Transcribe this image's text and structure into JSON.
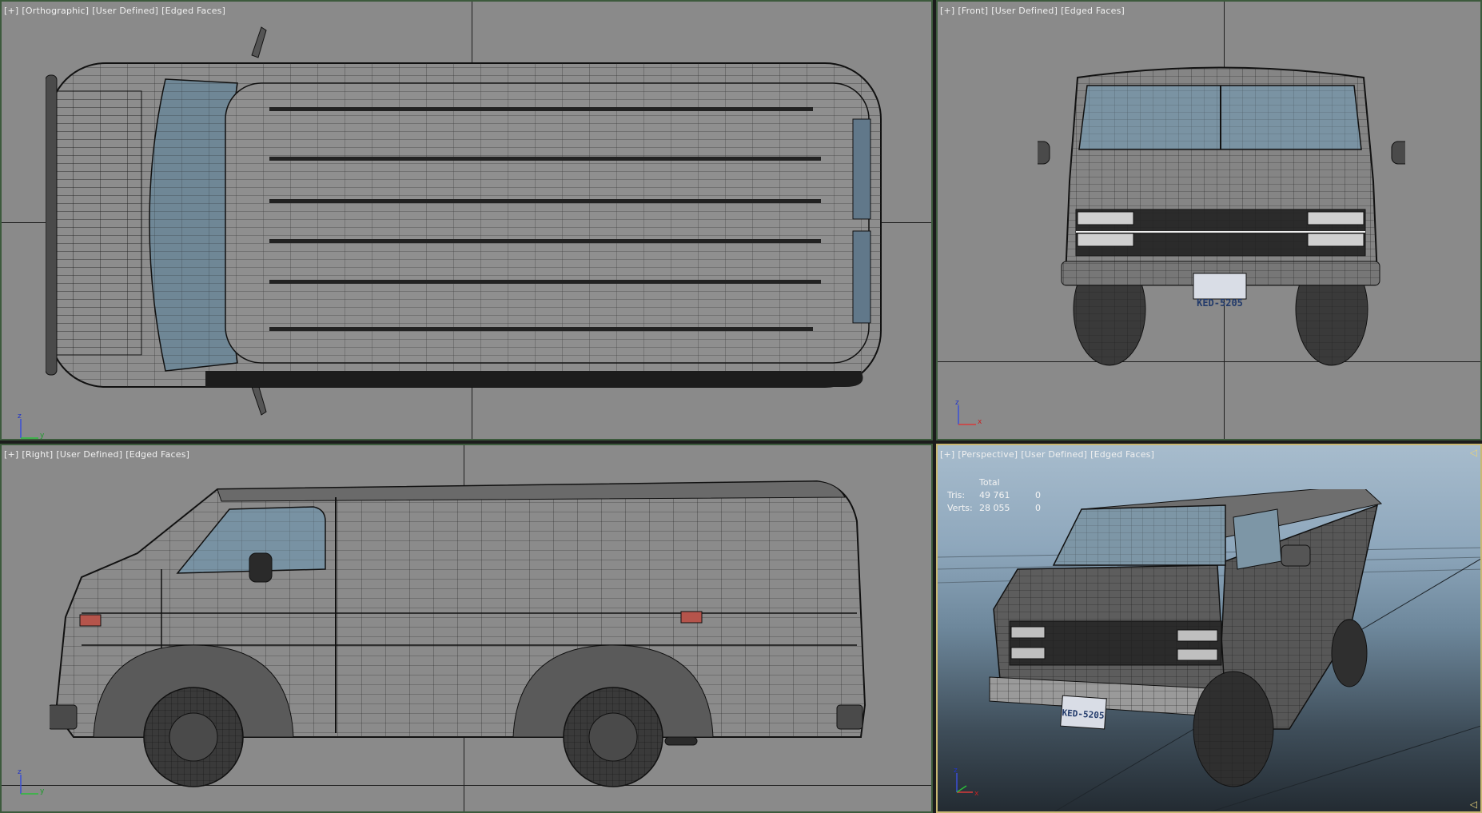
{
  "viewports": {
    "top": {
      "label_plus": "[+]",
      "label_view": "[Orthographic]",
      "label_shading": "[User Defined]",
      "label_faces": "[Edged Faces]"
    },
    "front": {
      "label_plus": "[+]",
      "label_view": "[Front]",
      "label_shading": "[User Defined]",
      "label_faces": "[Edged Faces]",
      "plate": "KED-5205"
    },
    "right": {
      "label_plus": "[+]",
      "label_view": "[Right]",
      "label_shading": "[User Defined]",
      "label_faces": "[Edged Faces]"
    },
    "perspective": {
      "label_plus": "[+]",
      "label_view": "[Perspective]",
      "label_shading": "[User Defined]",
      "label_faces": "[Edged Faces]",
      "plate": "KED-5205",
      "stats": {
        "header": "Total",
        "tris_label": "Tris:",
        "tris_total": "49 761",
        "tris_selected": "0",
        "verts_label": "Verts:",
        "verts_total": "28 055",
        "verts_selected": "0"
      }
    }
  },
  "axis": {
    "x": "x",
    "y": "y",
    "z": "z"
  },
  "colors": {
    "viewport_bg": "#8a8a8a",
    "active_border": "#c9b873",
    "inactive_border": "#3c5a3c",
    "glass": "#7f98a8",
    "wire": "#1a1a1a"
  }
}
